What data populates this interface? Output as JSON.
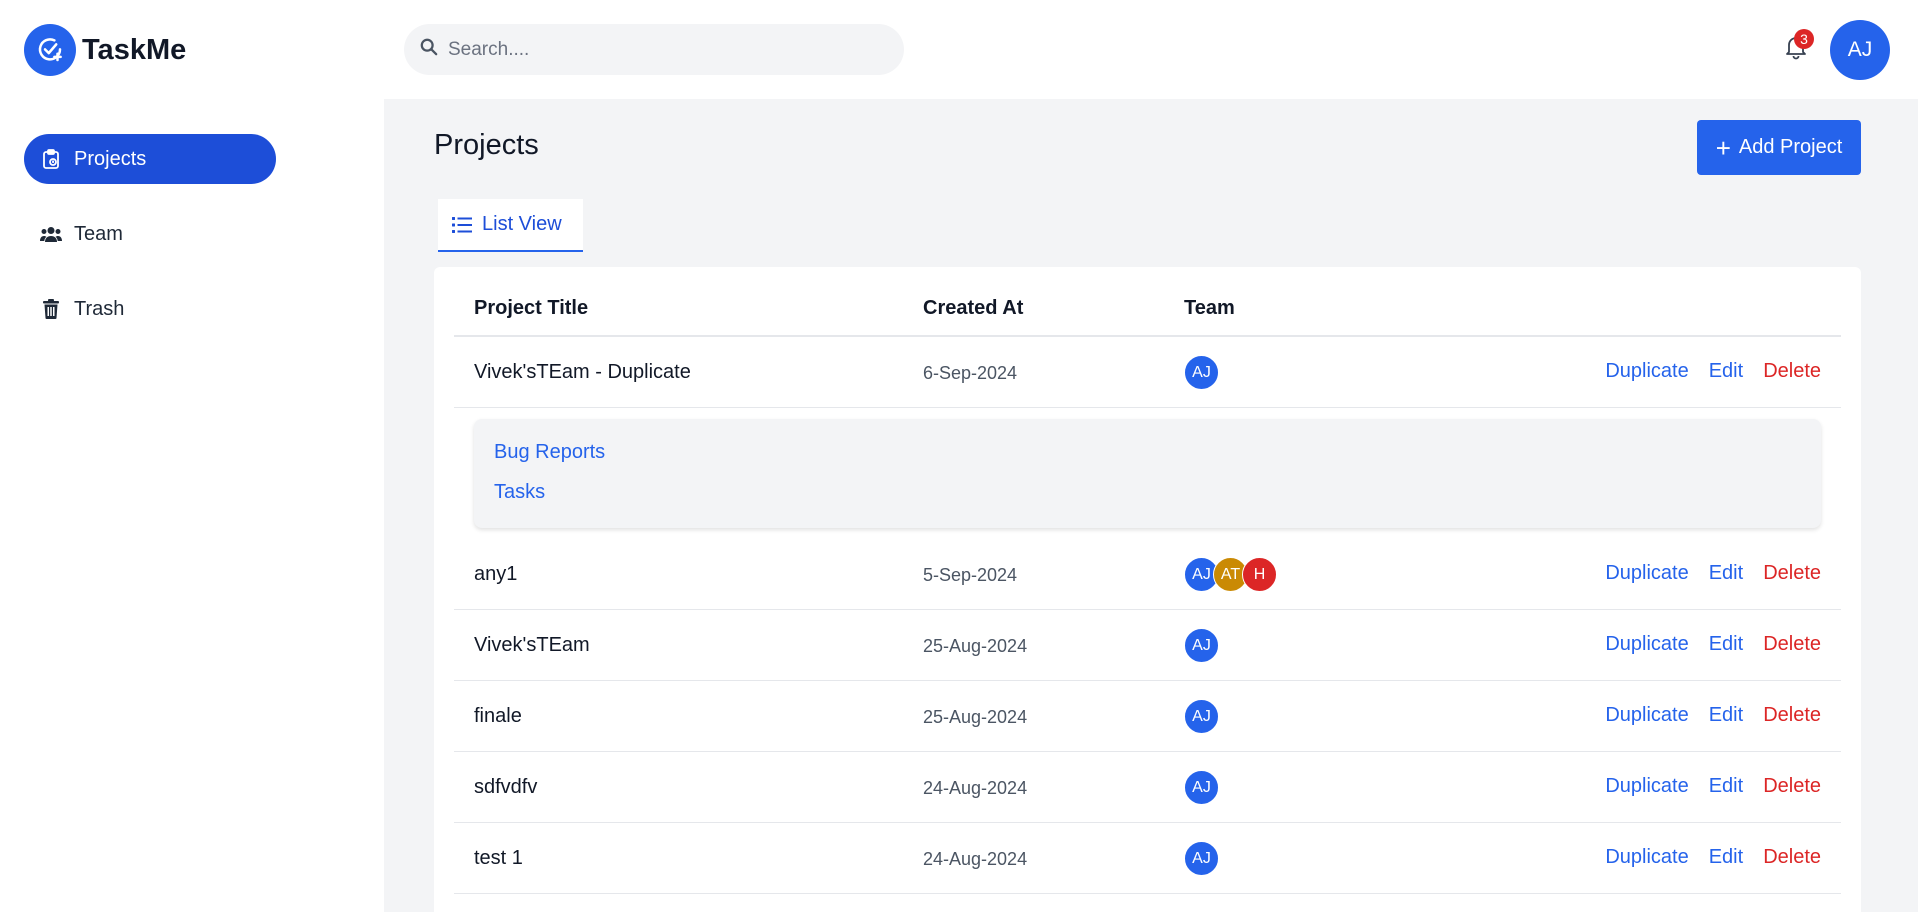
{
  "app": {
    "name": "TaskMe"
  },
  "sidebar": {
    "items": [
      {
        "label": "Projects",
        "icon": "clipboard-icon",
        "active": true
      },
      {
        "label": "Team",
        "icon": "users-icon",
        "active": false
      },
      {
        "label": "Trash",
        "icon": "trash-icon",
        "active": false
      }
    ]
  },
  "search": {
    "placeholder": "Search...."
  },
  "notifications": {
    "count": "3"
  },
  "user": {
    "initials": "AJ"
  },
  "page": {
    "title": "Projects",
    "add_label": "Add Project",
    "tab_label": "List View"
  },
  "table": {
    "headers": [
      "Project Title",
      "Created At",
      "Team"
    ],
    "action_labels": {
      "duplicate": "Duplicate",
      "edit": "Edit",
      "delete": "Delete"
    },
    "rows": [
      {
        "title": "Vivek'sTEam - Duplicate",
        "date": "6-Sep-2024",
        "team": [
          {
            "initials": "AJ",
            "color": "#2563eb"
          }
        ]
      },
      {
        "title": "any1",
        "date": "5-Sep-2024",
        "team": [
          {
            "initials": "AJ",
            "color": "#2563eb"
          },
          {
            "initials": "AT",
            "color": "#ca8a04"
          },
          {
            "initials": "H",
            "color": "#dc2626"
          }
        ]
      },
      {
        "title": "Vivek'sTEam",
        "date": "25-Aug-2024",
        "team": [
          {
            "initials": "AJ",
            "color": "#2563eb"
          }
        ]
      },
      {
        "title": "finale",
        "date": "25-Aug-2024",
        "team": [
          {
            "initials": "AJ",
            "color": "#2563eb"
          }
        ]
      },
      {
        "title": "sdfvdfv",
        "date": "24-Aug-2024",
        "team": [
          {
            "initials": "AJ",
            "color": "#2563eb"
          }
        ]
      },
      {
        "title": "test 1",
        "date": "24-Aug-2024",
        "team": [
          {
            "initials": "AJ",
            "color": "#2563eb"
          }
        ]
      }
    ],
    "expanded_links": [
      "Bug Reports",
      "Tasks"
    ]
  },
  "colors": {
    "accent": "#2563eb",
    "danger": "#dc2626",
    "background": "#f3f4f6"
  }
}
